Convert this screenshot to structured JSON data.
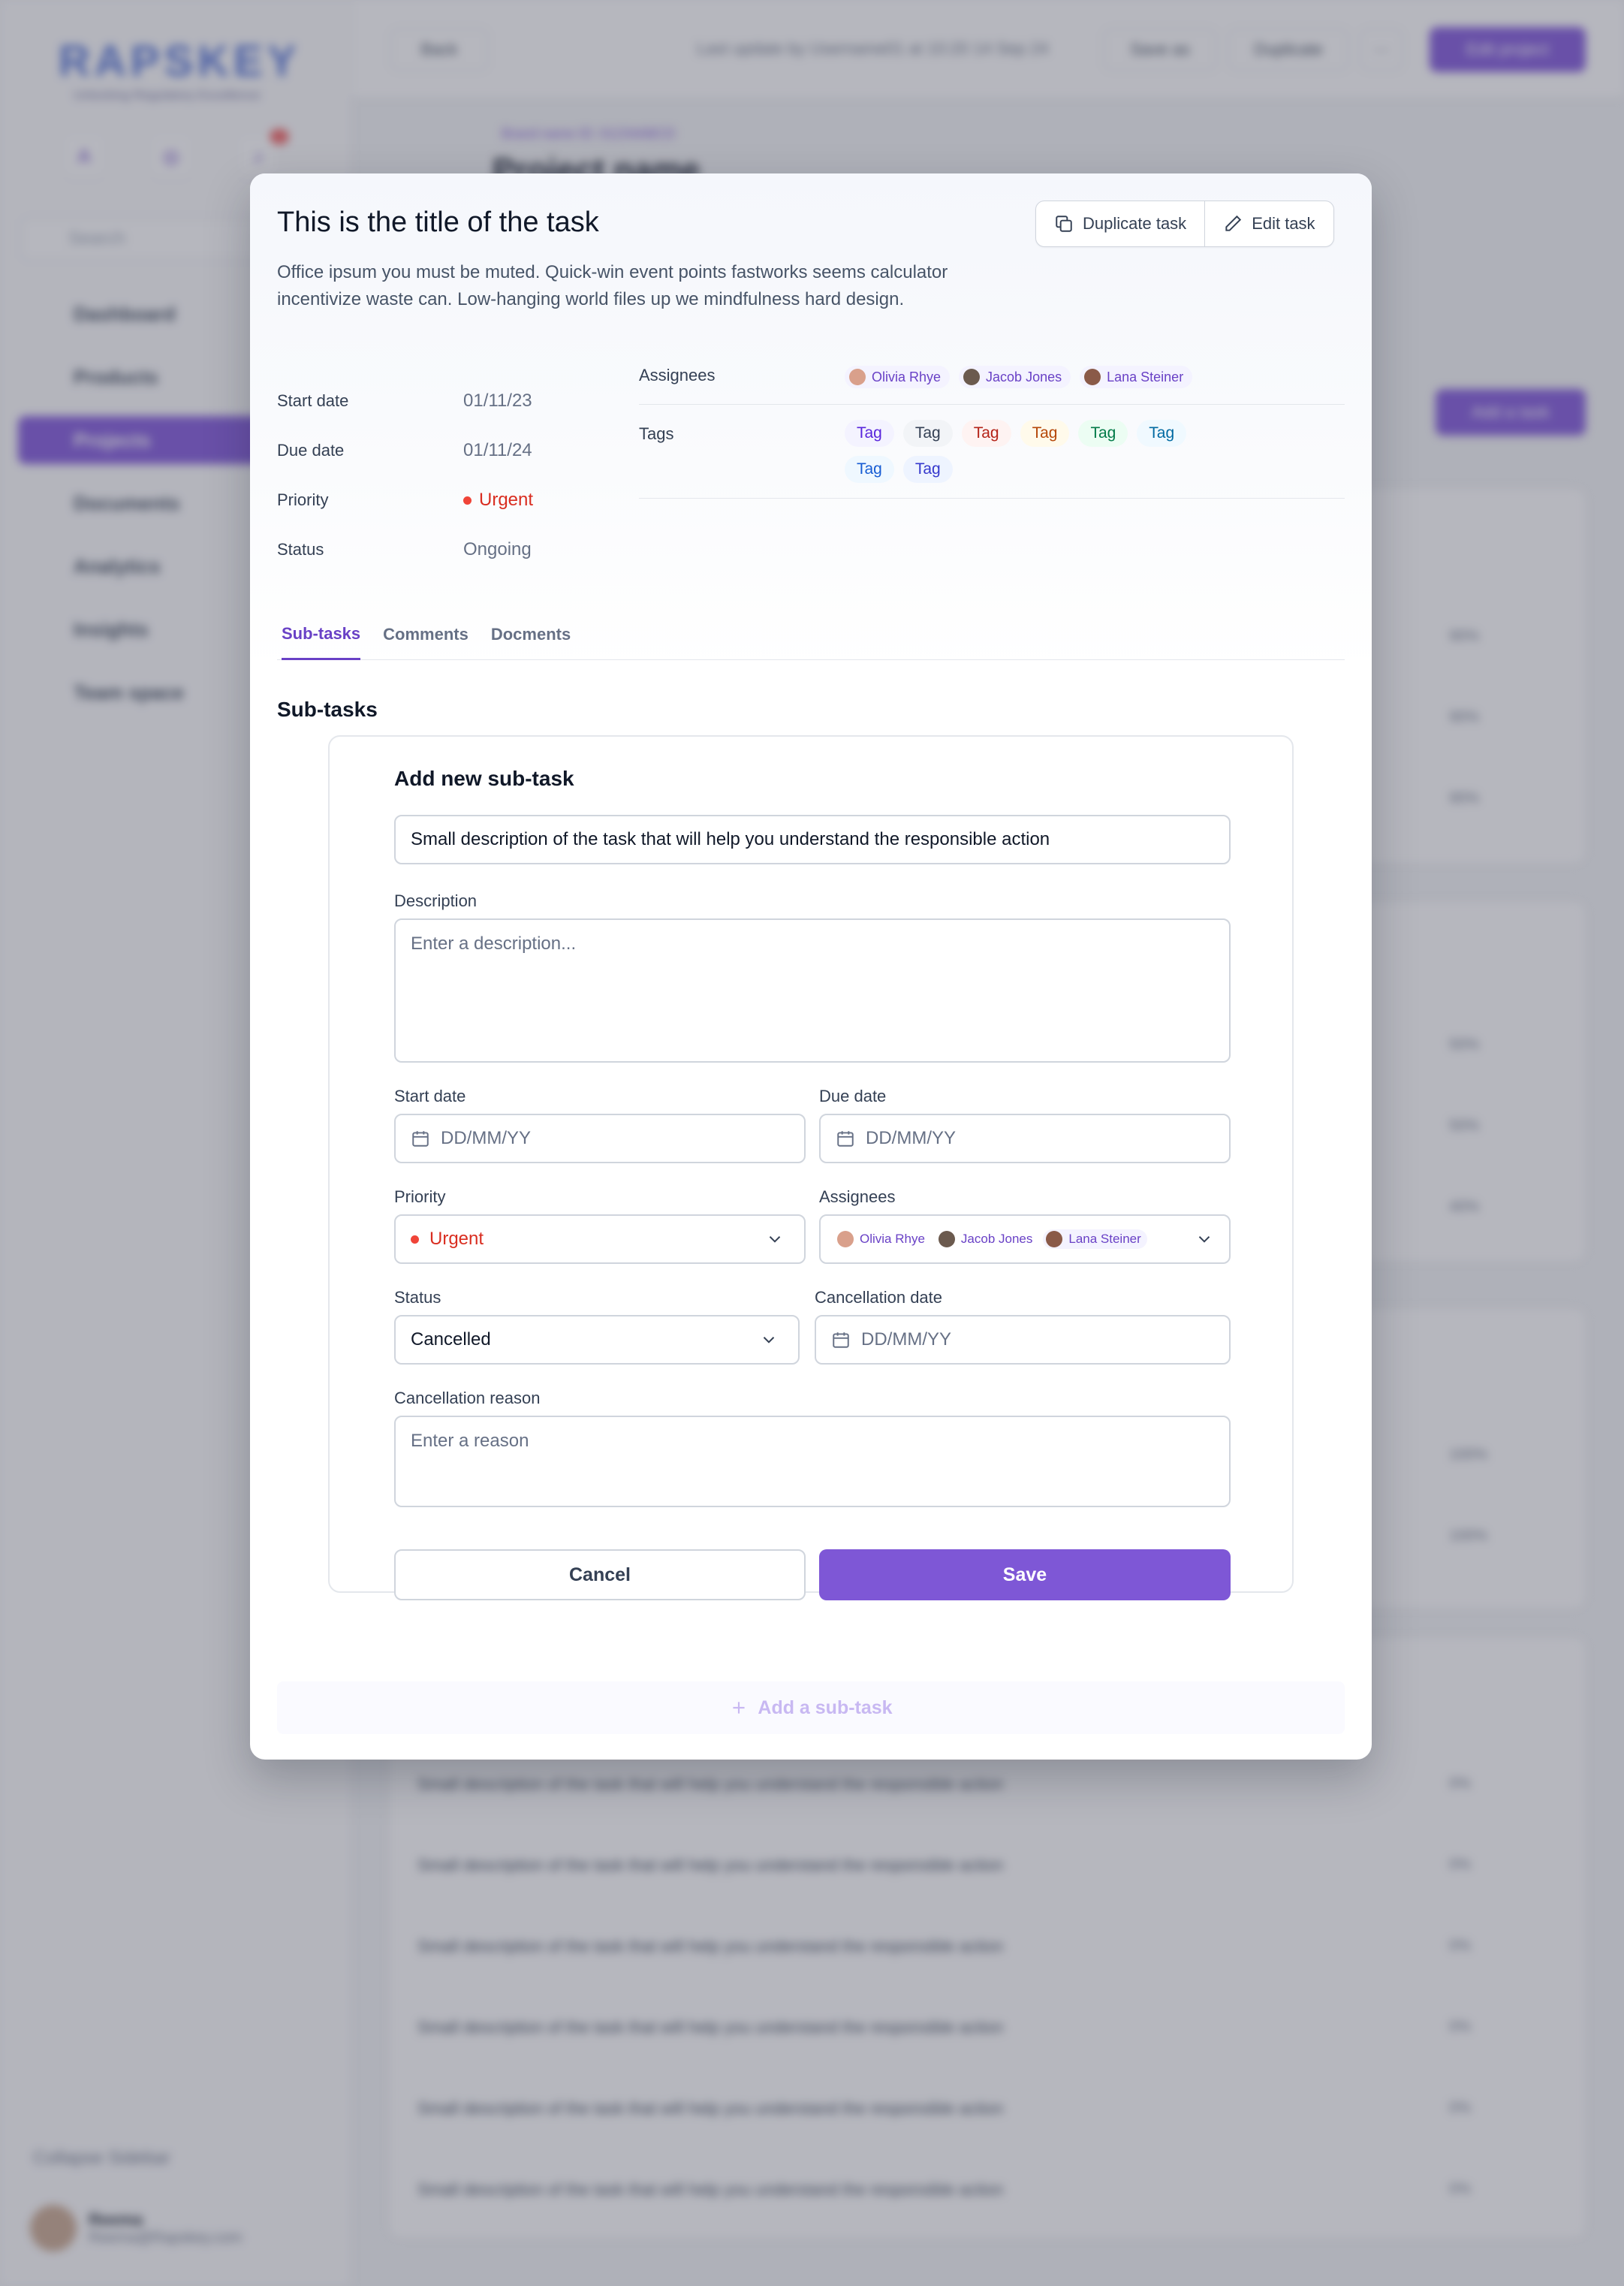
{
  "background": {
    "logo": {
      "word": "RAPSKEY",
      "tagline": "Unlocking Regulatory Excellence"
    },
    "notification_count": "2",
    "search_placeholder": "Search",
    "nav": [
      {
        "label": "Dashboard"
      },
      {
        "label": "Products"
      },
      {
        "label": "Projects"
      },
      {
        "label": "Documents"
      },
      {
        "label": "Analytics"
      },
      {
        "label": "Insights"
      },
      {
        "label": "Team space"
      }
    ],
    "collapse_label": "Collapse Sidebar",
    "user": {
      "name": "Reema",
      "email": "Reema@Rapskey.com"
    },
    "topbar": {
      "back": "Back",
      "last_update": "Last update by Username01 at 10:20 14 Sep 24",
      "save_as": "Save as",
      "duplicate": "Duplicate",
      "more": "···",
      "edit_project": "Edit project"
    },
    "breadcrumb": "Brand name  ID: 01234ABCD",
    "project_name": "Project name",
    "add_task": "Add a task",
    "row_text": "Small description of the task that will help you understand the responsible action",
    "row_dash": "–",
    "pcts_top": [
      "90%",
      "90%",
      "90%"
    ],
    "pcts_mid": [
      "50%",
      "50%",
      "40%"
    ],
    "pcts_low": [
      "100%",
      "100%"
    ],
    "pcts_bottom": [
      "0%",
      "0%",
      "0%",
      "0%",
      "0%",
      "0%"
    ]
  },
  "modal": {
    "title": "This is the title of the task",
    "description": "Office ipsum you must be muted. Quick-win event points fastworks seems calculator incentivize waste can. Low-hanging world files up we mindfulness hard design.",
    "duplicate_label": "Duplicate task",
    "edit_label": "Edit task",
    "meta": {
      "start_date": {
        "label": "Start date",
        "value": "01/11/23"
      },
      "due_date": {
        "label": "Due date",
        "value": "01/11/24"
      },
      "priority": {
        "label": "Priority",
        "value": "Urgent"
      },
      "status": {
        "label": "Status",
        "value": "Ongoing"
      }
    },
    "assignees_label": "Assignees",
    "assignees": [
      {
        "name": "Olivia Rhye",
        "avatar": "#d9a08b"
      },
      {
        "name": "Jacob Jones",
        "avatar": "#6b5a4e"
      },
      {
        "name": "Lana Steiner",
        "avatar": "#8a5a48"
      }
    ],
    "tags_label": "Tags",
    "tags": [
      {
        "label": "Tag",
        "bg": "#f4f3ff",
        "fg": "#5925dc"
      },
      {
        "label": "Tag",
        "bg": "#f2f4f7",
        "fg": "#344054"
      },
      {
        "label": "Tag",
        "bg": "#fef3f2",
        "fg": "#b42318"
      },
      {
        "label": "Tag",
        "bg": "#fffaeb",
        "fg": "#b54708"
      },
      {
        "label": "Tag",
        "bg": "#ecfdf3",
        "fg": "#027a48"
      },
      {
        "label": "Tag",
        "bg": "#f0f9ff",
        "fg": "#026aa2"
      },
      {
        "label": "Tag",
        "bg": "#eff8ff",
        "fg": "#175cd3"
      },
      {
        "label": "Tag",
        "bg": "#eef4ff",
        "fg": "#3538cd"
      }
    ],
    "tabs": [
      {
        "label": "Sub-tasks"
      },
      {
        "label": "Comments"
      },
      {
        "label": "Docments"
      }
    ],
    "subtasks_heading": "Sub-tasks",
    "form": {
      "title": "Add new sub-task",
      "task_value": "Small description of the task that will help you understand the responsible action",
      "description_label": "Description",
      "description_placeholder": "Enter a description...",
      "start_date_label": "Start date",
      "start_date_placeholder": "DD/MM/YY",
      "due_date_label": "Due date",
      "due_date_placeholder": "DD/MM/YY",
      "priority_label": "Priority",
      "priority_value": "Urgent",
      "assignees_label": "Assignees",
      "status_label": "Status",
      "status_value": "Cancelled",
      "cancellation_date_label": "Cancellation date",
      "cancellation_date_placeholder": "DD/MM/YY",
      "cancellation_reason_label": "Cancellation reason",
      "cancellation_reason_placeholder": "Enter a reason",
      "cancel_label": "Cancel",
      "save_label": "Save"
    },
    "add_subtask_label": "Add a sub-task"
  },
  "colors": {
    "accent": "#7e57d6",
    "urgent": "#d92d20"
  }
}
